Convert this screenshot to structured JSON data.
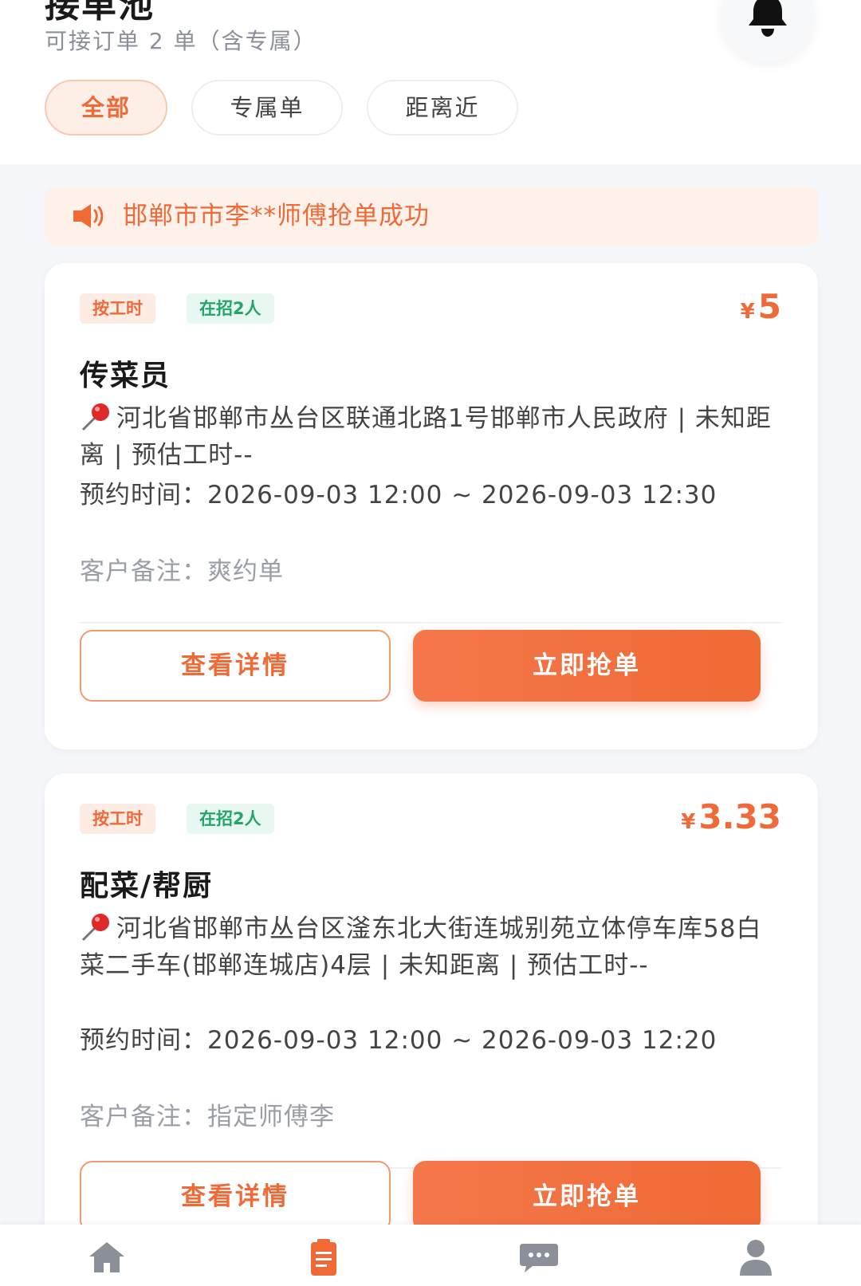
{
  "header": {
    "title": "接单池",
    "subtitle": "可接订单 2 单（含专属）",
    "bell_icon": "bell-icon"
  },
  "filters": [
    {
      "label": "全部",
      "active": true
    },
    {
      "label": "专属单",
      "active": false
    },
    {
      "label": "距离近",
      "active": false
    }
  ],
  "notice": {
    "icon": "speaker-icon",
    "text": "邯郸市市李**师傅抢单成功"
  },
  "orders": [
    {
      "tag_type": "按工时",
      "tag_hire": "在招2人",
      "currency": "¥",
      "price": "5",
      "title": "传菜员",
      "address": "河北省邯郸市丛台区联通北路1号邯郸市人民政府 | 未知距离 | 预估工时--",
      "time": "预约时间：2026-09-03 12:00 ~ 2026-09-03 12:30",
      "note": "客户备注：爽约单",
      "detail_label": "查看详情",
      "grab_label": "立即抢单"
    },
    {
      "tag_type": "按工时",
      "tag_hire": "在招2人",
      "currency": "¥",
      "price": "3.33",
      "title": "配菜/帮厨",
      "address": "河北省邯郸市丛台区滏东北大街连城别苑立体停车库58白菜二手车(邯郸连城店)4层 | 未知距离 | 预估工时--",
      "time": "预约时间：2026-09-03 12:00 ~ 2026-09-03 12:20",
      "note": "客户备注：指定师傅李",
      "detail_label": "查看详情",
      "grab_label": "立即抢单"
    }
  ],
  "tabbar": {
    "items": [
      {
        "icon": "home-icon",
        "active": false
      },
      {
        "icon": "orders-icon",
        "active": true
      },
      {
        "icon": "messages-icon",
        "active": false
      },
      {
        "icon": "profile-icon",
        "active": false
      }
    ]
  },
  "colors": {
    "accent": "#f06a38",
    "green": "#22a569",
    "inactive_icon": "#8a8f98"
  }
}
